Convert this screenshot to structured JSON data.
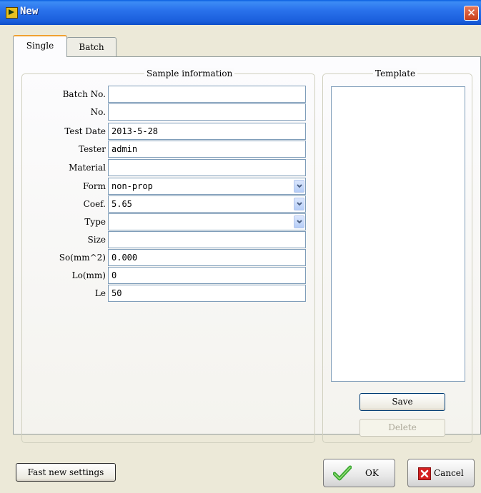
{
  "window": {
    "title": "New",
    "close_glyph": "✕"
  },
  "tabs": [
    {
      "label": "Single",
      "active": true
    },
    {
      "label": "Batch",
      "active": false
    }
  ],
  "sample": {
    "title": "Sample information",
    "fields": [
      {
        "label": "Batch No.",
        "value": ""
      },
      {
        "label": "No.",
        "value": ""
      },
      {
        "label": "Test Date",
        "value": "2013-5-28"
      },
      {
        "label": "Tester",
        "value": "admin"
      },
      {
        "label": "Material",
        "value": ""
      },
      {
        "label": "Form",
        "value": "non-prop",
        "dropdown": true
      },
      {
        "label": "Coef.",
        "value": "5.65",
        "dropdown": true
      },
      {
        "label": "Type",
        "value": "",
        "dropdown": true
      },
      {
        "label": "Size",
        "value": ""
      },
      {
        "label": "So(mm^2)",
        "value": "0.000"
      },
      {
        "label": "Lo(mm)",
        "value": "0"
      },
      {
        "label": "Le",
        "value": "50"
      }
    ]
  },
  "template": {
    "title": "Template",
    "save_label": "Save",
    "delete_label": "Delete"
  },
  "footer": {
    "fast_new_label": "Fast new settings",
    "ok_label": "OK",
    "cancel_label": "Cancel"
  },
  "icons": {
    "ok": "check-icon",
    "cancel": "cancel-x-icon",
    "app": "app-icon"
  },
  "colors": {
    "titlebar": "#2a72ec",
    "accent_tab": "#f0a030",
    "cancel_red": "#d42020",
    "ok_green": "#3aa832"
  }
}
